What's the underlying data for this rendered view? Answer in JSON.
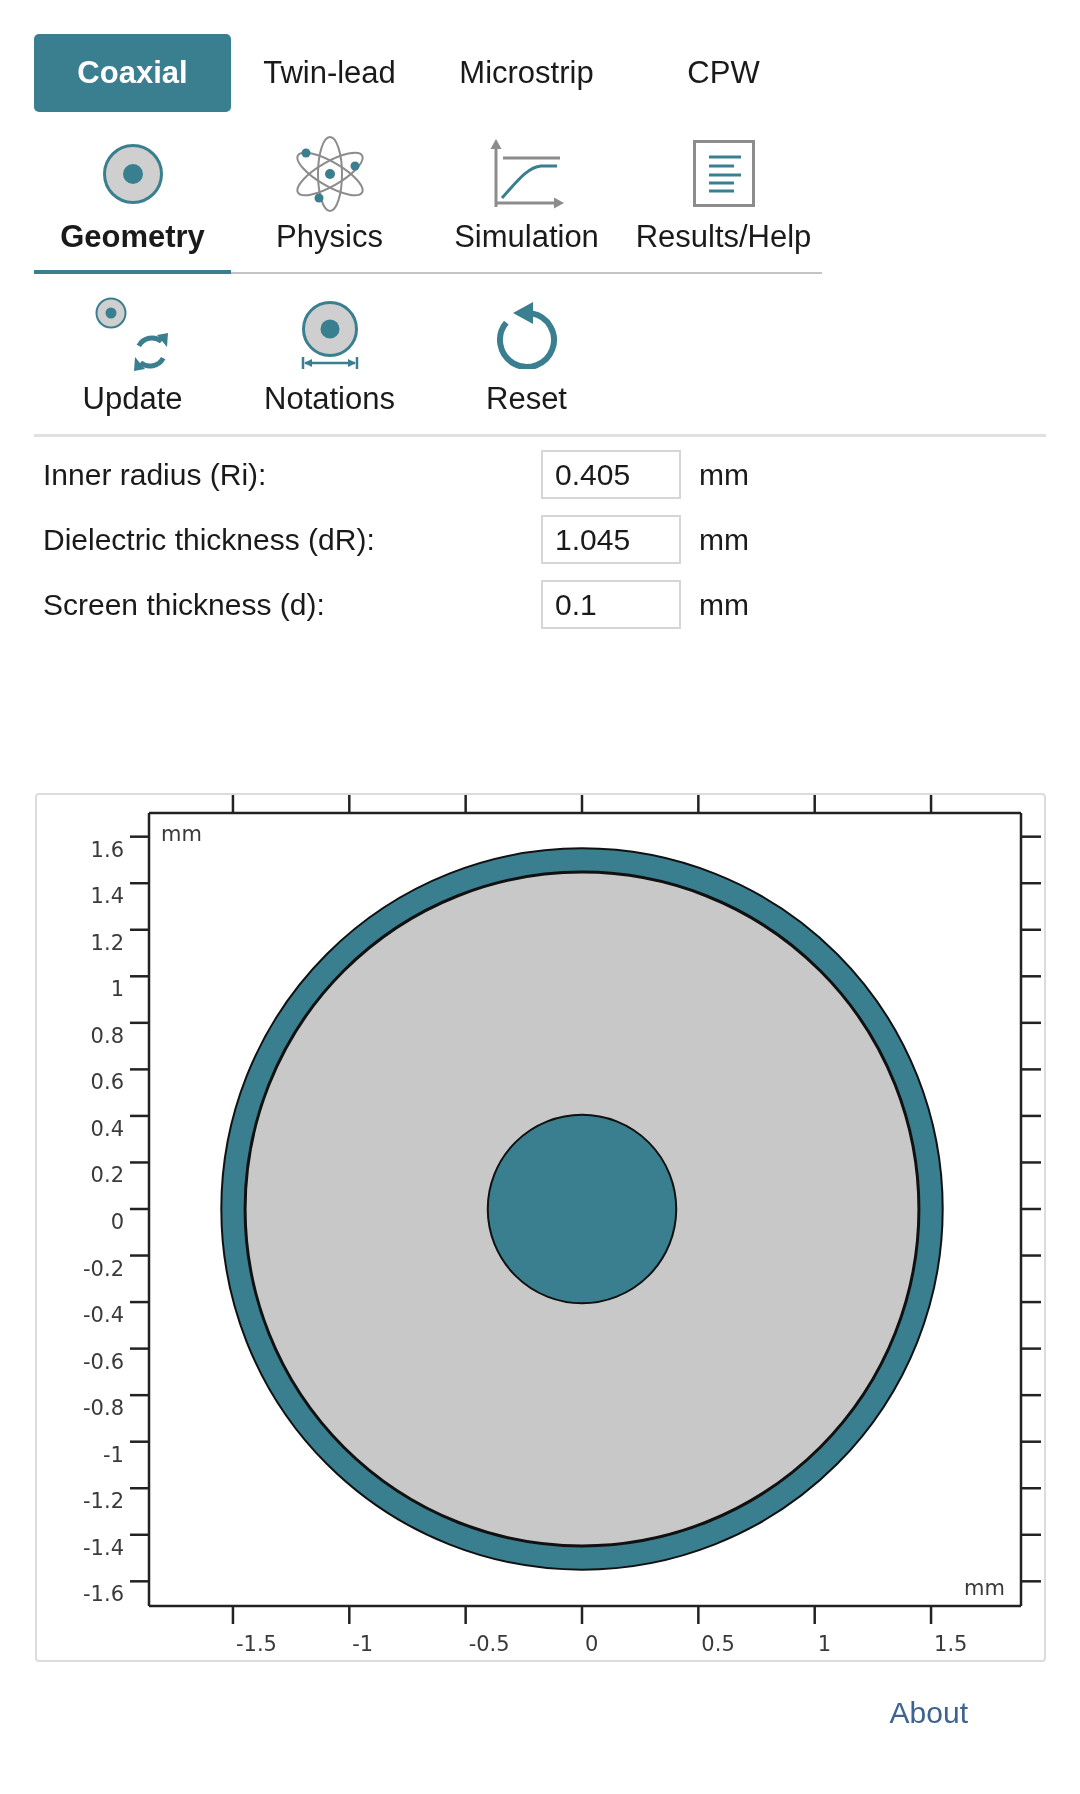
{
  "line_type_tabs": [
    {
      "label": "Coaxial",
      "selected": true
    },
    {
      "label": "Twin-lead",
      "selected": false
    },
    {
      "label": "Microstrip",
      "selected": false
    },
    {
      "label": "CPW",
      "selected": false
    }
  ],
  "section_tabs": [
    {
      "label": "Geometry",
      "kind": "geometry",
      "selected": true
    },
    {
      "label": "Physics",
      "kind": "physics",
      "selected": false
    },
    {
      "label": "Simulation",
      "kind": "simulation",
      "selected": false
    },
    {
      "label": "Results/Help",
      "kind": "results",
      "selected": false
    }
  ],
  "toolbar": [
    {
      "label": "Update",
      "kind": "update"
    },
    {
      "label": "Notations",
      "kind": "notations"
    },
    {
      "label": "Reset",
      "kind": "reset"
    }
  ],
  "parameters": [
    {
      "label": "Inner radius (Ri):",
      "value": "0.405",
      "unit": "mm"
    },
    {
      "label": "Dielectric thickness (dR):",
      "value": "1.045",
      "unit": "mm"
    },
    {
      "label": "Screen thickness (d):",
      "value": "0.1",
      "unit": "mm"
    }
  ],
  "geometry_plot": {
    "y_unit": "mm",
    "x_unit": "mm",
    "y_tick_labels": [
      "1.6",
      "1.4",
      "1.2",
      "1",
      "0.8",
      "0.6",
      "0.4",
      "0.2",
      "0",
      "-0.2",
      "-0.4",
      "-0.6",
      "-0.8",
      "-1",
      "-1.2",
      "-1.4",
      "-1.6"
    ],
    "x_tick_labels": [
      "-1.5",
      "-1",
      "-0.5",
      "0",
      "0.5",
      "1",
      "1.5"
    ]
  },
  "about_link": "About"
}
